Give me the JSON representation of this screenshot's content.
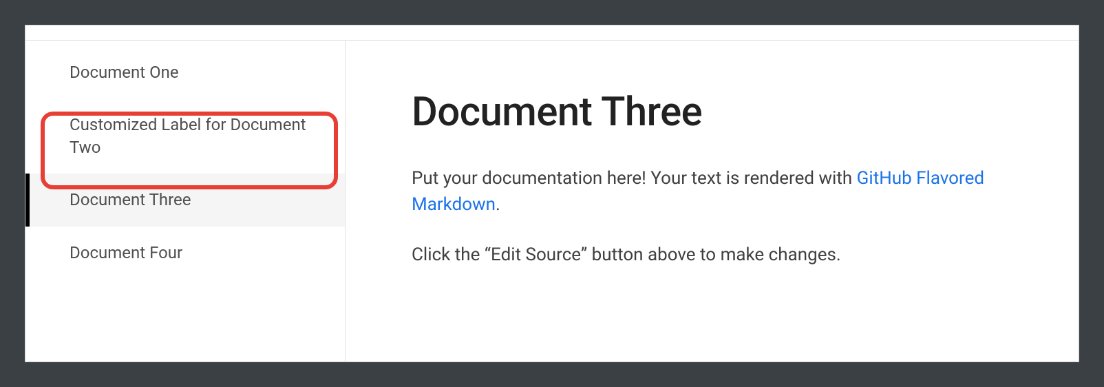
{
  "sidebar": {
    "items": [
      {
        "label": "Document One",
        "selected": false
      },
      {
        "label": "Customized Label for Document Two",
        "selected": false
      },
      {
        "label": "Document Three",
        "selected": true
      },
      {
        "label": "Document Four",
        "selected": false
      }
    ],
    "highlighted_index": 1
  },
  "content": {
    "title": "Document Three",
    "paragraph1_pre": "Put your documentation here! Your text is rendered with ",
    "paragraph1_link": "GitHub Flavored Markdown",
    "paragraph1_post": ".",
    "paragraph2": "Click the “Edit Source” button above to make changes."
  }
}
